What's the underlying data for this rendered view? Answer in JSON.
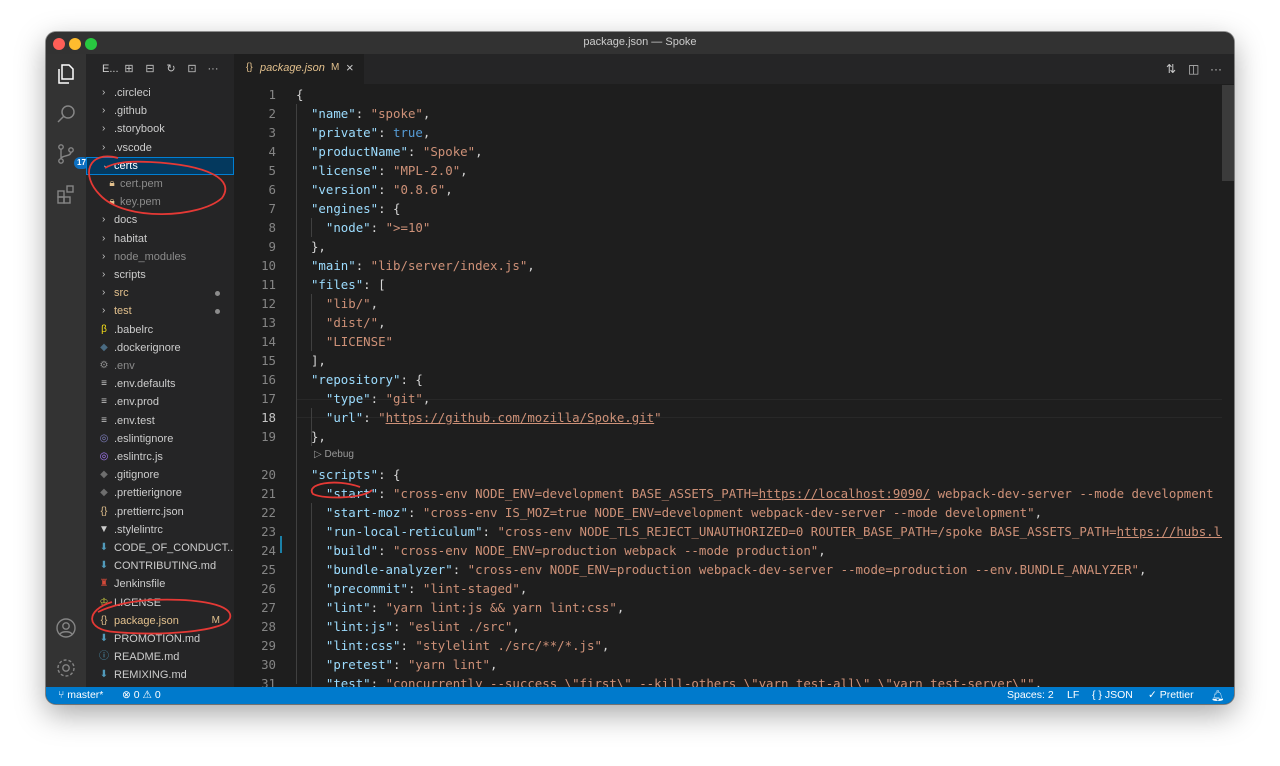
{
  "window": {
    "title": "package.json — Spoke"
  },
  "activity_bar": {
    "source_control_badge": "17"
  },
  "explorer": {
    "header_label": "E...",
    "items": [
      {
        "name": ".circleci",
        "type": "folder",
        "color": "#cccccc"
      },
      {
        "name": ".github",
        "type": "folder",
        "color": "#cccccc"
      },
      {
        "name": ".storybook",
        "type": "folder",
        "color": "#cccccc"
      },
      {
        "name": ".vscode",
        "type": "folder",
        "color": "#cccccc"
      },
      {
        "name": "certs",
        "type": "folder-open",
        "color": "#ffffff"
      },
      {
        "name": "cert.pem",
        "type": "file",
        "color": "#8b8b8b"
      },
      {
        "name": "key.pem",
        "type": "file",
        "color": "#8b8b8b"
      },
      {
        "name": "docs",
        "type": "folder",
        "color": "#cccccc"
      },
      {
        "name": "habitat",
        "type": "folder",
        "color": "#cccccc"
      },
      {
        "name": "node_modules",
        "type": "folder",
        "color": "#8b8b8b"
      },
      {
        "name": "scripts",
        "type": "folder",
        "color": "#cccccc"
      },
      {
        "name": "src",
        "type": "folder",
        "color": "#e2c08d"
      },
      {
        "name": "test",
        "type": "folder",
        "color": "#e2c08d"
      },
      {
        "name": ".babelrc",
        "type": "file",
        "color": "#cccccc"
      },
      {
        "name": ".dockerignore",
        "type": "file",
        "color": "#cccccc"
      },
      {
        "name": ".env",
        "type": "file",
        "color": "#8b8b8b"
      },
      {
        "name": ".env.defaults",
        "type": "file",
        "color": "#cccccc"
      },
      {
        "name": ".env.prod",
        "type": "file",
        "color": "#cccccc"
      },
      {
        "name": ".env.test",
        "type": "file",
        "color": "#cccccc"
      },
      {
        "name": ".eslintignore",
        "type": "file",
        "color": "#cccccc"
      },
      {
        "name": ".eslintrc.js",
        "type": "file",
        "color": "#cccccc"
      },
      {
        "name": ".gitignore",
        "type": "file",
        "color": "#cccccc"
      },
      {
        "name": ".prettierignore",
        "type": "file",
        "color": "#cccccc"
      },
      {
        "name": ".prettierrc.json",
        "type": "file",
        "color": "#cccccc"
      },
      {
        "name": ".stylelintrc",
        "type": "file",
        "color": "#cccccc"
      },
      {
        "name": "CODE_OF_CONDUCT....",
        "type": "file",
        "color": "#cccccc"
      },
      {
        "name": "CONTRIBUTING.md",
        "type": "file",
        "color": "#cccccc"
      },
      {
        "name": "Jenkinsfile",
        "type": "file",
        "color": "#cccccc"
      },
      {
        "name": "LICENSE",
        "type": "file",
        "color": "#cccccc"
      },
      {
        "name": "package.json",
        "type": "file",
        "color": "#e2c08d",
        "decoration": "M"
      },
      {
        "name": "PROMOTION.md",
        "type": "file",
        "color": "#cccccc"
      },
      {
        "name": "README.md",
        "type": "file",
        "color": "#cccccc"
      },
      {
        "name": "REMIXING.md",
        "type": "file",
        "color": "#cccccc"
      }
    ]
  },
  "tab": {
    "icon": "{}",
    "name": "package.json",
    "modified": "M",
    "close": "×"
  },
  "code": {
    "codelens": "▷ Debug",
    "lines": [
      {
        "n": "1",
        "t": "{"
      },
      {
        "n": "2",
        "t": "  \"name\": \"spoke\","
      },
      {
        "n": "3",
        "t": "  \"private\": true,"
      },
      {
        "n": "4",
        "t": "  \"productName\": \"Spoke\","
      },
      {
        "n": "5",
        "t": "  \"license\": \"MPL-2.0\","
      },
      {
        "n": "6",
        "t": "  \"version\": \"0.8.6\","
      },
      {
        "n": "7",
        "t": "  \"engines\": {"
      },
      {
        "n": "8",
        "t": "    \"node\": \">=10\""
      },
      {
        "n": "9",
        "t": "  },"
      },
      {
        "n": "10",
        "t": "  \"main\": \"lib/server/index.js\","
      },
      {
        "n": "11",
        "t": "  \"files\": ["
      },
      {
        "n": "12",
        "t": "    \"lib/\","
      },
      {
        "n": "13",
        "t": "    \"dist/\","
      },
      {
        "n": "14",
        "t": "    \"LICENSE\""
      },
      {
        "n": "15",
        "t": "  ],"
      },
      {
        "n": "16",
        "t": "  \"repository\": {"
      },
      {
        "n": "17",
        "t": "    \"type\": \"git\","
      },
      {
        "n": "18",
        "t": "    \"url\": \"https://github.com/mozilla/Spoke.git\""
      },
      {
        "n": "19",
        "t": "  },"
      },
      {
        "n": "20",
        "t": "  \"scripts\": {"
      },
      {
        "n": "21",
        "t": "    \"start\": \"cross-env NODE_ENV=development BASE_ASSETS_PATH=https://localhost:9090/ webpack-dev-server --mode development --"
      },
      {
        "n": "22",
        "t": "    \"start-moz\": \"cross-env IS_MOZ=true NODE_ENV=development webpack-dev-server --mode development\","
      },
      {
        "n": "23",
        "t": "    \"run-local-reticulum\": \"cross-env NODE_TLS_REJECT_UNAUTHORIZED=0 ROUTER_BASE_PATH=/spoke BASE_ASSETS_PATH=https://hubs.loc"
      },
      {
        "n": "24",
        "t": "    \"build\": \"cross-env NODE_ENV=production webpack --mode production\","
      },
      {
        "n": "25",
        "t": "    \"bundle-analyzer\": \"cross-env NODE_ENV=production webpack-dev-server --mode=production --env.BUNDLE_ANALYZER\","
      },
      {
        "n": "26",
        "t": "    \"precommit\": \"lint-staged\","
      },
      {
        "n": "27",
        "t": "    \"lint\": \"yarn lint:js && yarn lint:css\","
      },
      {
        "n": "28",
        "t": "    \"lint:js\": \"eslint ./src\","
      },
      {
        "n": "29",
        "t": "    \"lint:css\": \"stylelint ./src/**/*.js\","
      },
      {
        "n": "30",
        "t": "    \"pretest\": \"yarn lint\","
      },
      {
        "n": "31",
        "t": "    \"test\": \"concurrently --success \\\"first\\\" --kill-others \\\"yarn test-all\\\" \\\"yarn test-server\\\"\","
      }
    ]
  },
  "statusbar": {
    "branch": "master*",
    "errors": "0",
    "warnings": "0",
    "spaces": "Spaces: 2",
    "eol": "LF",
    "language": "JSON",
    "formatter": "Prettier"
  },
  "colors": {
    "accent": "#007acc",
    "annotation": "#e53935"
  }
}
